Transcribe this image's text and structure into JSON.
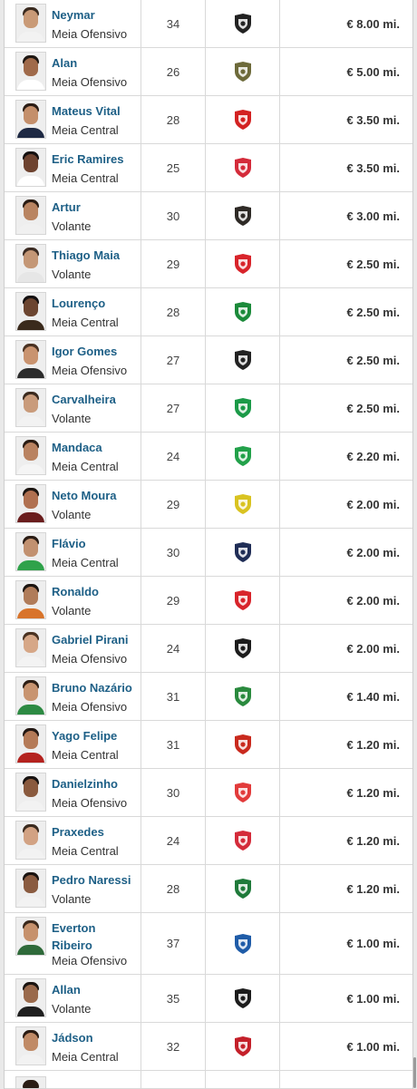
{
  "players": [
    {
      "name": "Neymar",
      "position": "Meia Ofensivo",
      "age": "34",
      "value": "€ 8.00 mi.",
      "club_icon": "santos-crest-icon",
      "club_color": "#222222",
      "club_bg": "#ffffff",
      "skin": "#c99a77",
      "hair": "#3a2a1f",
      "shirt": "#f2f2f2"
    },
    {
      "name": "Alan",
      "position": "Meia Ofensivo",
      "age": "26",
      "value": "€ 5.00 mi.",
      "club_icon": "winged-crest-icon",
      "club_color": "#6d6a3a",
      "club_bg": "#ffffff",
      "skin": "#a06a4a",
      "hair": "#1e1712",
      "shirt": "#ffffff"
    },
    {
      "name": "Mateus Vital",
      "position": "Meia Central",
      "age": "28",
      "value": "€ 3.50 mi.",
      "club_icon": "red-crest-icon",
      "club_color": "#d32222",
      "club_bg": "#ffffff",
      "skin": "#c48f6b",
      "hair": "#2b1d15",
      "shirt": "#1f2a44"
    },
    {
      "name": "Eric Ramires",
      "position": "Meia Central",
      "age": "25",
      "value": "€ 3.50 mi.",
      "club_icon": "red-bull-crest-icon",
      "club_color": "#d42b3a",
      "club_bg": "#ffffff",
      "skin": "#6e4330",
      "hair": "#151010",
      "shirt": "#ffffff"
    },
    {
      "name": "Artur",
      "position": "Volante",
      "age": "30",
      "value": "€ 3.00 mi.",
      "club_icon": "dark-crest-icon",
      "club_color": "#2e2a26",
      "club_bg": "#ffffff",
      "skin": "#b98461",
      "hair": "#2a1c13",
      "shirt": "#f0f0f0"
    },
    {
      "name": "Thiago Maia",
      "position": "Volante",
      "age": "29",
      "value": "€ 2.50 mi.",
      "club_icon": "internacional-crest-icon",
      "club_color": "#d8242b",
      "club_bg": "#ffffff",
      "skin": "#c49776",
      "hair": "#3b2b22",
      "shirt": "#e6e6e6"
    },
    {
      "name": "Lourenço",
      "position": "Meia Central",
      "age": "28",
      "value": "€ 2.50 mi.",
      "club_icon": "goias-crest-icon",
      "club_color": "#1b8a3a",
      "club_bg": "#ffffff",
      "skin": "#6c4530",
      "hair": "#141010",
      "shirt": "#3a2a1c"
    },
    {
      "name": "Igor Gomes",
      "position": "Meia Ofensivo",
      "age": "27",
      "value": "€ 2.50 mi.",
      "club_icon": "atletico-mg-crest-icon",
      "club_color": "#222222",
      "club_bg": "#ffffff",
      "skin": "#c9936f",
      "hair": "#4a3222",
      "shirt": "#2c2c2c"
    },
    {
      "name": "Carvalheira",
      "position": "Volante",
      "age": "27",
      "value": "€ 2.50 mi.",
      "club_icon": "chapecoense-crest-icon",
      "club_color": "#1b9a48",
      "club_bg": "#ffffff",
      "skin": "#c99b7b",
      "hair": "#3b2a1e",
      "shirt": "#f2f2f2"
    },
    {
      "name": "Mandaca",
      "position": "Meia Central",
      "age": "24",
      "value": "€ 2.20 mi.",
      "club_icon": "juventude-crest-icon",
      "club_color": "#22a14a",
      "club_bg": "#ffffff",
      "skin": "#b98260",
      "hair": "#2a1b12",
      "shirt": "#f5f5f5"
    },
    {
      "name": "Neto Moura",
      "position": "Volante",
      "age": "29",
      "value": "€ 2.00 mi.",
      "club_icon": "mirassol-crest-icon",
      "club_color": "#d9c321",
      "club_bg": "#ffffff",
      "skin": "#b07050",
      "hair": "#1b1410",
      "shirt": "#6a1d1d"
    },
    {
      "name": "Flávio",
      "position": "Meia Central",
      "age": "30",
      "value": "€ 2.00 mi.",
      "club_icon": "novorizontino-crest-icon",
      "club_color": "#1f2d56",
      "club_bg": "#ffffff",
      "skin": "#c29170",
      "hair": "#2a1c14",
      "shirt": "#2fa24a"
    },
    {
      "name": "Ronaldo",
      "position": "Volante",
      "age": "29",
      "value": "€ 2.00 mi.",
      "club_icon": "internacional-crest-icon",
      "club_color": "#d8242b",
      "club_bg": "#ffffff",
      "skin": "#b07c5a",
      "hair": "#1c1510",
      "shirt": "#d8742b"
    },
    {
      "name": "Gabriel Pirani",
      "position": "Meia Ofensivo",
      "age": "24",
      "value": "€ 2.00 mi.",
      "club_icon": "dc-united-crest-icon",
      "club_color": "#1c1c1c",
      "club_bg": "#ffffff",
      "skin": "#d6a787",
      "hair": "#4a3221",
      "shirt": "#f3f3f3"
    },
    {
      "name": "Bruno Nazário",
      "position": "Meia Ofensivo",
      "age": "31",
      "value": "€ 1.40 mi.",
      "club_icon": "america-crest-icon",
      "club_color": "#2a8a3e",
      "club_bg": "#ffffff",
      "skin": "#c89470",
      "hair": "#2d1e14",
      "shirt": "#2d8a43"
    },
    {
      "name": "Yago Felipe",
      "position": "Meia Central",
      "age": "31",
      "value": "€ 1.20 mi.",
      "club_icon": "sport-crest-icon",
      "club_color": "#c92a1e",
      "club_bg": "#ffffff",
      "skin": "#b47a57",
      "hair": "#221712",
      "shirt": "#b4221e"
    },
    {
      "name": "Danielzinho",
      "position": "Meia Ofensivo",
      "age": "30",
      "value": "€ 1.20 mi.",
      "club_icon": "crb-crest-icon",
      "club_color": "#e23b3b",
      "club_bg": "#ffffff",
      "skin": "#8a5a3e",
      "hair": "#171210",
      "shirt": "#f2f2f2"
    },
    {
      "name": "Praxedes",
      "position": "Meia Central",
      "age": "24",
      "value": "€ 1.20 mi.",
      "club_icon": "red-bull-crest-icon",
      "club_color": "#d42b3a",
      "club_bg": "#ffffff",
      "skin": "#d2a283",
      "hair": "#3a2a1e",
      "shirt": "#f2f2f2"
    },
    {
      "name": "Pedro Naressi",
      "position": "Volante",
      "age": "28",
      "value": "€ 1.20 mi.",
      "club_icon": "green-crest-icon",
      "club_color": "#1f7a3a",
      "club_bg": "#ffffff",
      "skin": "#8a5b40",
      "hair": "#1a1310",
      "shirt": "#f2f2f2"
    },
    {
      "name": "Everton Ribeiro",
      "position": "Meia Ofensivo",
      "age": "37",
      "value": "€ 1.00 mi.",
      "club_icon": "bahia-crest-icon",
      "club_color": "#1f5ca8",
      "club_bg": "#ffffff",
      "skin": "#c6916c",
      "hair": "#3a281b",
      "shirt": "#2f6a3a"
    },
    {
      "name": "Allan",
      "position": "Volante",
      "age": "35",
      "value": "€ 1.00 mi.",
      "club_icon": "botafogo-crest-icon",
      "club_color": "#1c1c1c",
      "club_bg": "#ffffff",
      "skin": "#9a6a4c",
      "hair": "#1a1410",
      "shirt": "#1f1f1f"
    },
    {
      "name": "Jádson",
      "position": "Meia Central",
      "age": "32",
      "value": "€ 1.00 mi.",
      "club_icon": "athletico-pr-crest-icon",
      "club_color": "#c4202a",
      "club_bg": "#ffffff",
      "skin": "#c08a66",
      "hair": "#2a1b12",
      "shirt": "#f2f2f2"
    }
  ]
}
